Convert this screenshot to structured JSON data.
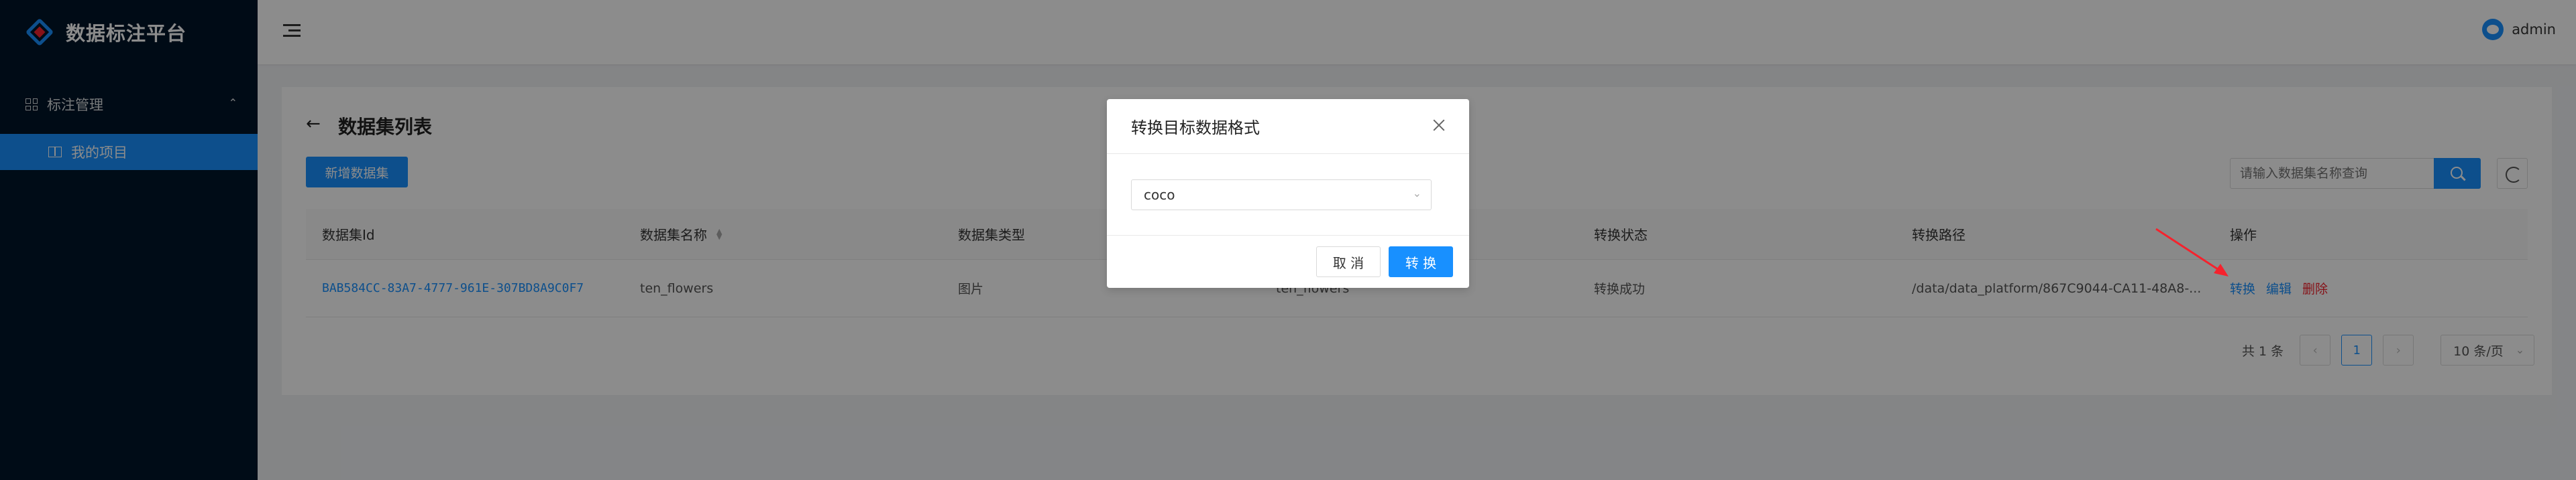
{
  "app": {
    "title": "数据标注平台"
  },
  "sidebar": {
    "group_label": "标注管理",
    "items": [
      {
        "label": "我的项目"
      }
    ]
  },
  "header": {
    "username": "admin"
  },
  "page": {
    "title": "数据集列表",
    "new_button": "新增数据集",
    "search_placeholder": "请输入数据集名称查询"
  },
  "table": {
    "columns": [
      "数据集Id",
      "数据集名称",
      "数据集类型",
      "",
      "转换状态",
      "转换路径",
      "操作"
    ],
    "rows": [
      {
        "id": "BAB584CC-83A7-4777-961E-307BD8A9C0F7",
        "name": "ten_flowers",
        "type": "图片",
        "col4": "ten_flowers",
        "status": "转换成功",
        "path": "/data/data_platform/867C9044-CA11-48A8-...",
        "actions": [
          "转换",
          "编辑",
          "删除"
        ]
      }
    ]
  },
  "pagination": {
    "total": "共 1 条",
    "current": "1",
    "page_size": "10 条/页"
  },
  "modal": {
    "title": "转换目标数据格式",
    "select_value": "coco",
    "cancel": "取 消",
    "ok": "转 换"
  },
  "colors": {
    "primary": "#1890ff",
    "danger": "#f5222d",
    "sidebar": "#001529"
  }
}
